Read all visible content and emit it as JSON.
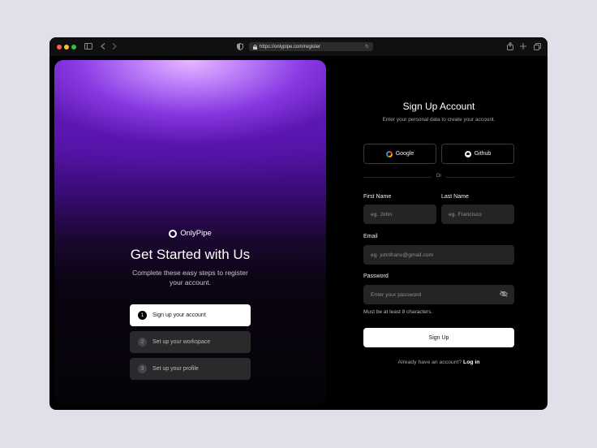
{
  "browser": {
    "url": "https://onlypipe.com/register",
    "icons": [
      "sidebar-icon",
      "back-icon",
      "forward-icon",
      "shield-icon",
      "lock-icon",
      "reload-icon",
      "share-icon",
      "new-tab-icon",
      "tabs-icon"
    ]
  },
  "hero": {
    "brand": "OnlyPipe",
    "title": "Get Started with Us",
    "subtitle": "Complete these easy steps to register your account.",
    "steps": [
      {
        "num": "1",
        "label": "Sign up your account",
        "active": true
      },
      {
        "num": "2",
        "label": "Set up your workspace",
        "active": false
      },
      {
        "num": "3",
        "label": "Set up your profile",
        "active": false
      }
    ]
  },
  "form": {
    "title": "Sign Up Account",
    "subtitle": "Enter your personal data to create your account.",
    "google_label": "Google",
    "github_label": "Github",
    "divider_text": "Or",
    "first_name": {
      "label": "First Name",
      "placeholder": "eg. John"
    },
    "last_name": {
      "label": "Last Name",
      "placeholder": "eg. Francisco"
    },
    "email": {
      "label": "Email",
      "placeholder": "eg. johnfrans@gmail.com"
    },
    "password": {
      "label": "Password",
      "placeholder": "Enter your password"
    },
    "hint": "Must be at least 8 characters.",
    "submit_label": "Sign Up",
    "login_prompt": "Already have an account?",
    "login_link": "Log in"
  },
  "colors": {
    "page_bg": "#dfe0ea",
    "window_bg": "#000000",
    "accent_purple": "#7a2ed8",
    "button_bg": "#ffffff"
  }
}
